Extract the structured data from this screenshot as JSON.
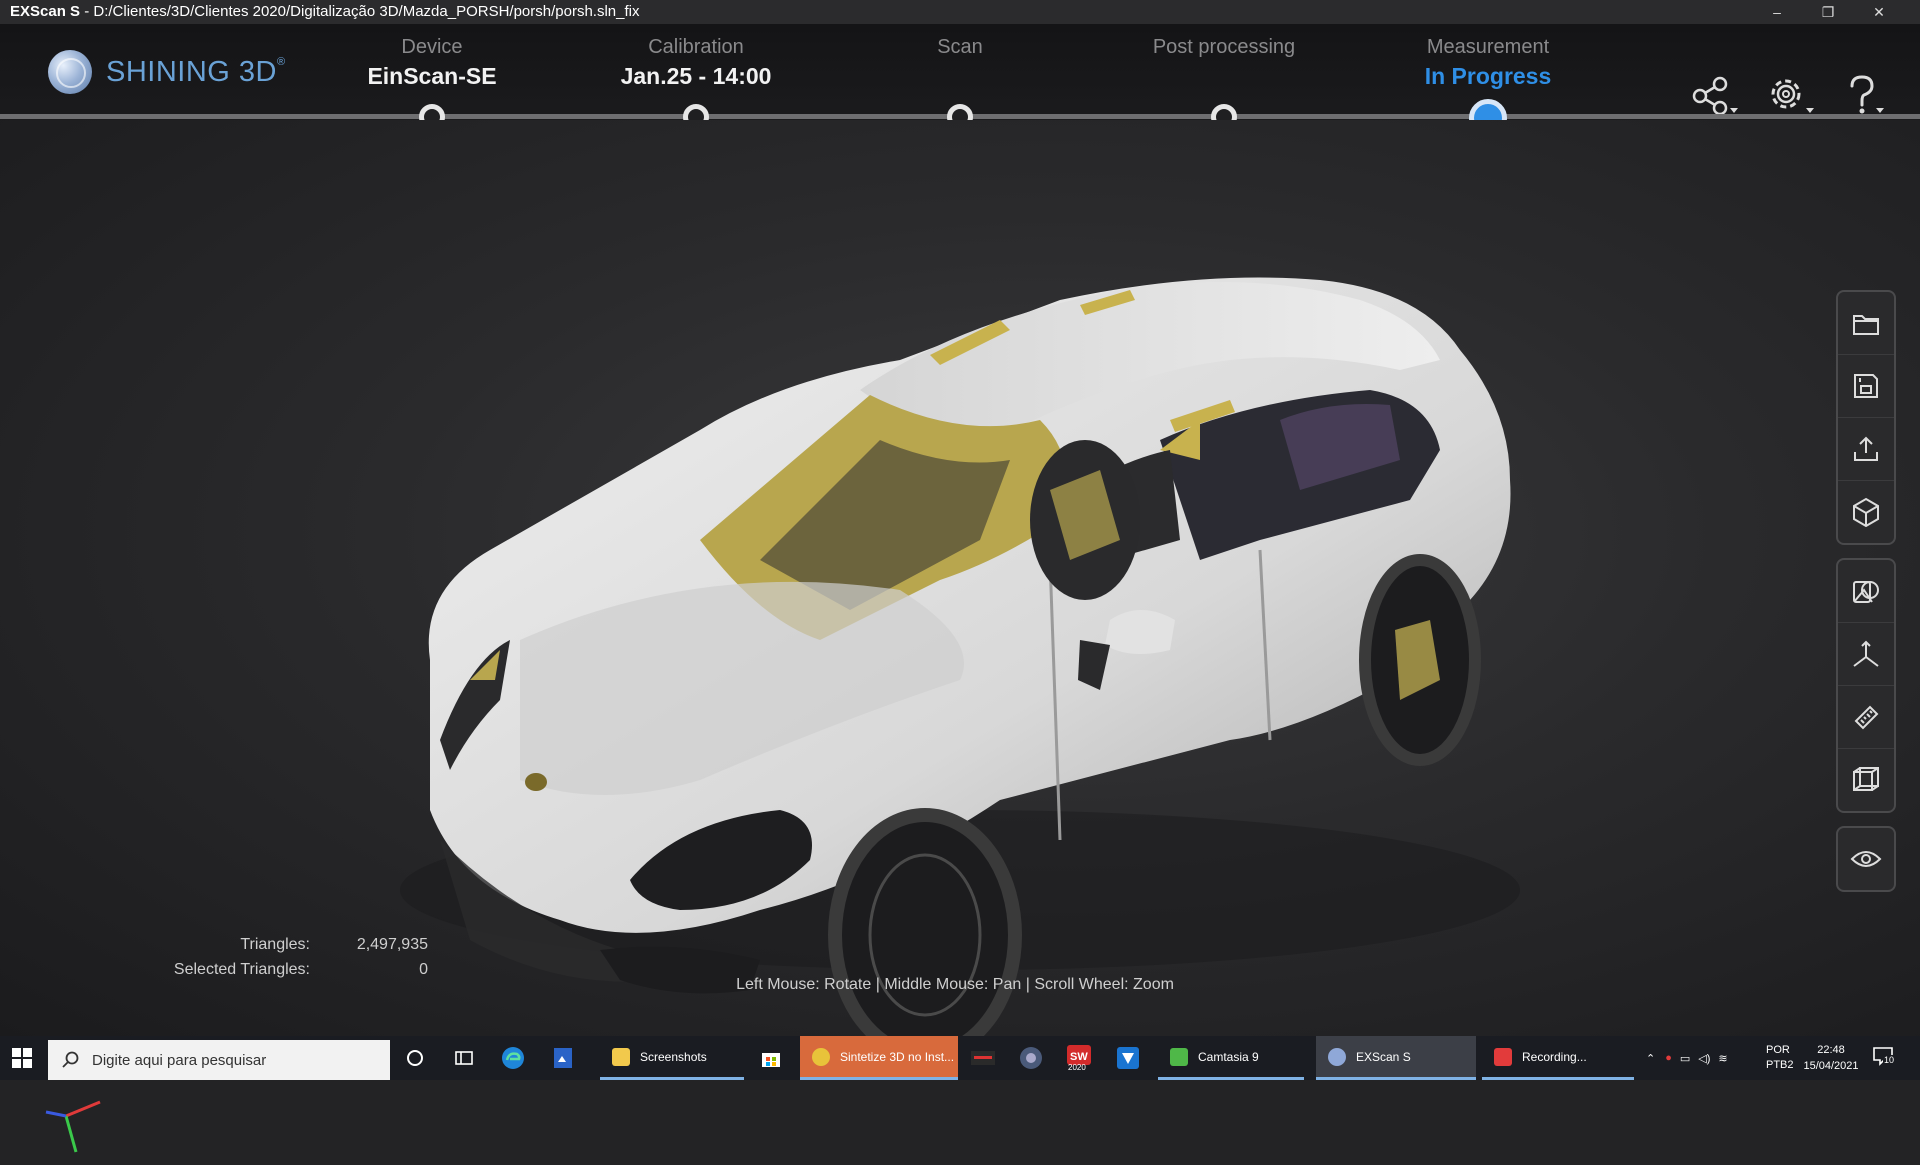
{
  "window": {
    "app_name": "EXScan S",
    "separator": " - ",
    "path": "D:/Clientes/3D/Clientes 2020/Digitalização 3D/Mazda_PORSH/porsh/porsh.sln_fix",
    "controls": {
      "minimize": "–",
      "restore": "❐",
      "close": "✕"
    }
  },
  "brand": {
    "name": "SHINING 3D",
    "registered": "®"
  },
  "steps": [
    {
      "label": "Device",
      "value": "EinScan-SE"
    },
    {
      "label": "Calibration",
      "value": "Jan.25 - 14:00"
    },
    {
      "label": "Scan",
      "value": ""
    },
    {
      "label": "Post processing",
      "value": ""
    },
    {
      "label": "Measurement",
      "value": "In Progress"
    }
  ],
  "header_icons": [
    "share-icon",
    "settings-icon",
    "help-icon"
  ],
  "toolbar_groups": [
    [
      "open-folder-icon",
      "save-icon",
      "export-icon",
      "model-cube-icon"
    ],
    [
      "reference-shape-icon",
      "coordinate-axes-icon",
      "measure-ruler-icon",
      "bounding-box-icon"
    ],
    [
      "visibility-eye-icon"
    ]
  ],
  "stats": {
    "triangles_label": "Triangles:",
    "triangles_value": "2,497,935",
    "selected_label": "Selected Triangles:",
    "selected_value": "0"
  },
  "hint": "Left Mouse: Rotate | Middle Mouse: Pan | Scroll Wheel: Zoom",
  "colors": {
    "accent": "#2f8fe6",
    "scan_surface": "#e8e8e8",
    "scan_backside": "#b9a852"
  },
  "taskbar": {
    "search_placeholder": "Digite aqui para pesquisar",
    "apps": {
      "screenshots": "Screenshots",
      "chrome": "Sintetize 3D no Inst...",
      "solidworks_year": "2020",
      "camtasia": "Camtasia 9",
      "exscan": "EXScan S",
      "recording": "Recording..."
    },
    "tray": {
      "lang": "POR",
      "layout": "PTB2",
      "time": "22:48",
      "date": "15/04/2021",
      "notifications": "10"
    }
  }
}
